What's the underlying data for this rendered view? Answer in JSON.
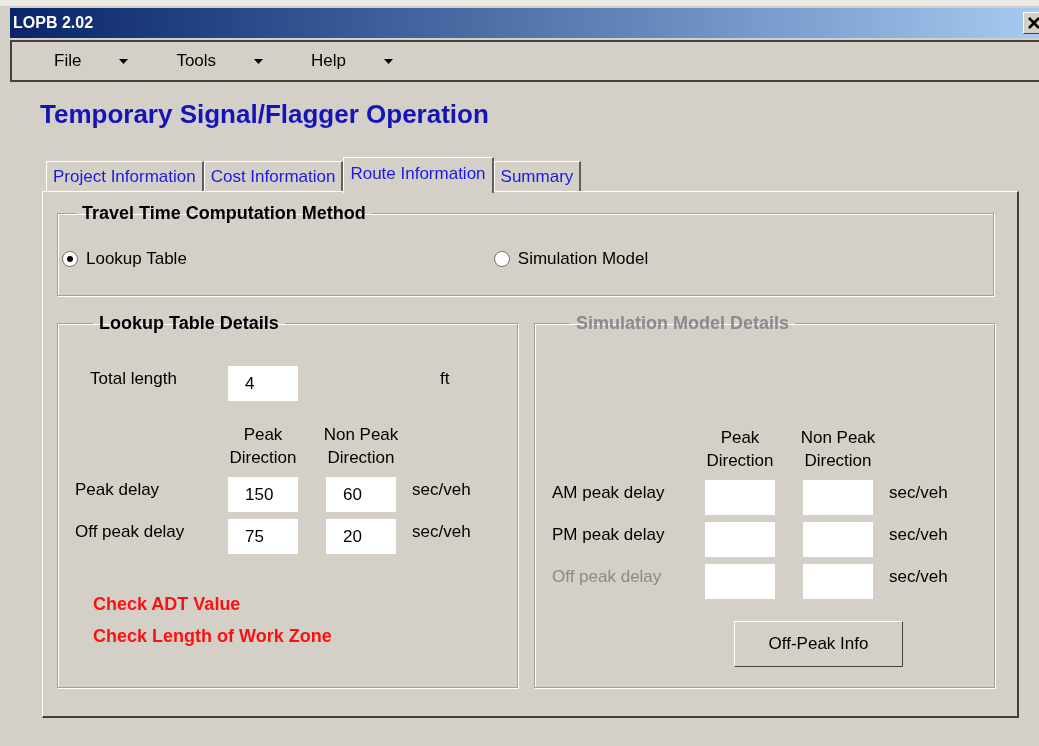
{
  "window": {
    "title": "LOPB 2.02"
  },
  "menu": [
    {
      "label": "File"
    },
    {
      "label": "Tools"
    },
    {
      "label": "Help"
    }
  ],
  "heading": "Temporary Signal/Flagger Operation",
  "tabs": [
    {
      "label": "Project Information",
      "selected": false
    },
    {
      "label": "Cost Information",
      "selected": false
    },
    {
      "label": "Route Information",
      "selected": true
    },
    {
      "label": "Summary",
      "selected": false
    }
  ],
  "method_group": {
    "title": "Travel Time Computation Method",
    "options": [
      {
        "label": "Lookup Table",
        "selected": true
      },
      {
        "label": "Simulation Model",
        "selected": false
      }
    ]
  },
  "lookup_group": {
    "title": "Lookup Table  Details",
    "disabled": false,
    "total_length": {
      "label": "Total length",
      "value": "4",
      "unit": "ft"
    },
    "column_headers": [
      [
        "Peak",
        "Direction"
      ],
      [
        "Non Peak",
        "Direction"
      ]
    ],
    "rows": [
      {
        "label": "Peak delay",
        "peak": "150",
        "non_peak": "60",
        "unit": "sec/veh",
        "disabled": false
      },
      {
        "label": "Off peak delay",
        "peak": "75",
        "non_peak": "20",
        "unit": "sec/veh",
        "disabled": false
      }
    ],
    "warnings": [
      "Check ADT Value",
      "Check Length of Work Zone"
    ]
  },
  "simulation_group": {
    "title": "Simulation Model Details",
    "disabled": true,
    "column_headers": [
      [
        "Peak",
        "Direction"
      ],
      [
        "Non Peak",
        "Direction"
      ]
    ],
    "rows": [
      {
        "label": "AM peak delay",
        "unit": "sec/veh",
        "disabled": false
      },
      {
        "label": "PM peak delay",
        "unit": "sec/veh",
        "disabled": false
      },
      {
        "label": "Off peak delay",
        "unit": "sec/veh",
        "disabled": true
      }
    ],
    "button": "Off-Peak Info"
  }
}
